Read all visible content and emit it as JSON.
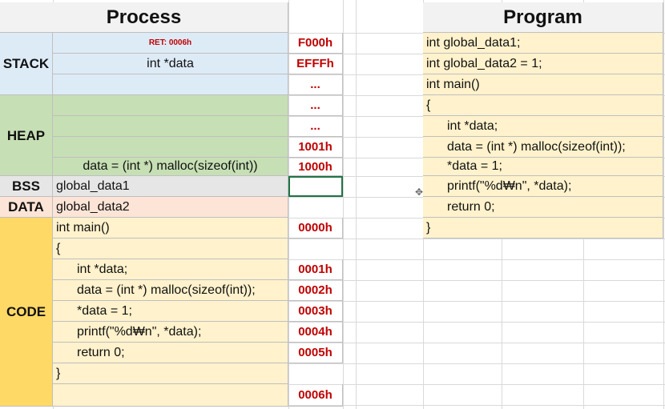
{
  "process": {
    "title": "Process",
    "segments": {
      "stack": "STACK",
      "heap": "HEAP",
      "bss": "BSS",
      "data": "DATA",
      "code": "CODE"
    },
    "stack_rows": [
      {
        "text": "RET: 0006h",
        "addr": "F000h"
      },
      {
        "text": "int *data",
        "addr": "EFFFh"
      },
      {
        "text": "",
        "addr": "..."
      }
    ],
    "heap_rows": [
      {
        "text": "",
        "addr": "..."
      },
      {
        "text": "",
        "addr": "..."
      },
      {
        "text": "",
        "addr": "1001h"
      },
      {
        "text": "data = (int *) malloc(sizeof(int))",
        "addr": "1000h"
      }
    ],
    "bss_row": {
      "text": "global_data1",
      "addr": ""
    },
    "data_row": {
      "text": "global_data2",
      "addr": ""
    },
    "code_rows": [
      {
        "text": "int main()",
        "addr": "0000h"
      },
      {
        "text": "{",
        "addr": ""
      },
      {
        "text": "int *data;",
        "addr": "0001h"
      },
      {
        "text": "data = (int *) malloc(sizeof(int));",
        "addr": "0002h"
      },
      {
        "text": "*data = 1;",
        "addr": "0003h"
      },
      {
        "text": "printf(\"%d₩n\", *data);",
        "addr": "0004h"
      },
      {
        "text": "return 0;",
        "addr": "0005h"
      },
      {
        "text": "}",
        "addr": ""
      },
      {
        "text": "",
        "addr": "0006h"
      }
    ]
  },
  "program": {
    "title": "Program",
    "lines": [
      "int global_data1;",
      "int global_data2 = 1;",
      "int main()",
      "{",
      "int *data;",
      "data = (int *) malloc(sizeof(int));",
      "*data = 1;",
      "printf(\"%d₩n\", *data);",
      "return 0;",
      "}"
    ]
  },
  "icons": {
    "cursor": "move-cursor-icon"
  },
  "colors": {
    "stack": "#ddebf7",
    "heap": "#c6dfb4",
    "bss": "#e7e6e6",
    "data": "#fce4d6",
    "code": "#ffd966",
    "code_cells": "#fff2cc",
    "address": "#c00000",
    "selection": "#217346"
  }
}
